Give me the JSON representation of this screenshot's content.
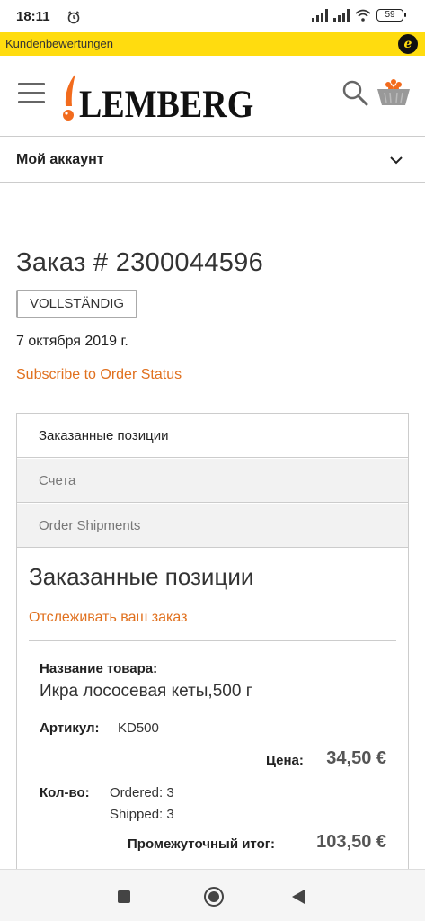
{
  "status_bar": {
    "time": "18:11",
    "battery": "59"
  },
  "trust_bar": {
    "label": "Kundenbewertungen",
    "badge": "e"
  },
  "header": {
    "logo_text": "LEMBERG"
  },
  "account": {
    "label": "Мой аккаунт"
  },
  "order": {
    "title": "Заказ # 2300044596",
    "status": "VOLLSTÄNDIG",
    "date": "7 октября 2019 г.",
    "subscribe_link": "Subscribe to Order Status"
  },
  "tabs": [
    {
      "label": "Заказанные позиции",
      "active": true
    },
    {
      "label": "Счета",
      "active": false
    },
    {
      "label": "Order Shipments",
      "active": false
    }
  ],
  "content": {
    "title": "Заказанные позиции",
    "track_link": "Отслеживать ваш заказ"
  },
  "item": {
    "name_label": "Название товара:",
    "name": "Икра лососевая кеты,500 г",
    "sku_label": "Артикул:",
    "sku": "KD500",
    "price_label": "Цена:",
    "price": "34,50 €",
    "qty_label": "Кол-во:",
    "qty_ordered": "Ordered: 3",
    "qty_shipped": "Shipped: 3",
    "subtotal_label": "Промежуточный итог:",
    "subtotal": "103,50 €"
  },
  "colors": {
    "accent": "#e0701e",
    "trust_yellow": "#ffdc0f",
    "logo_orange": "#f26b1d"
  }
}
